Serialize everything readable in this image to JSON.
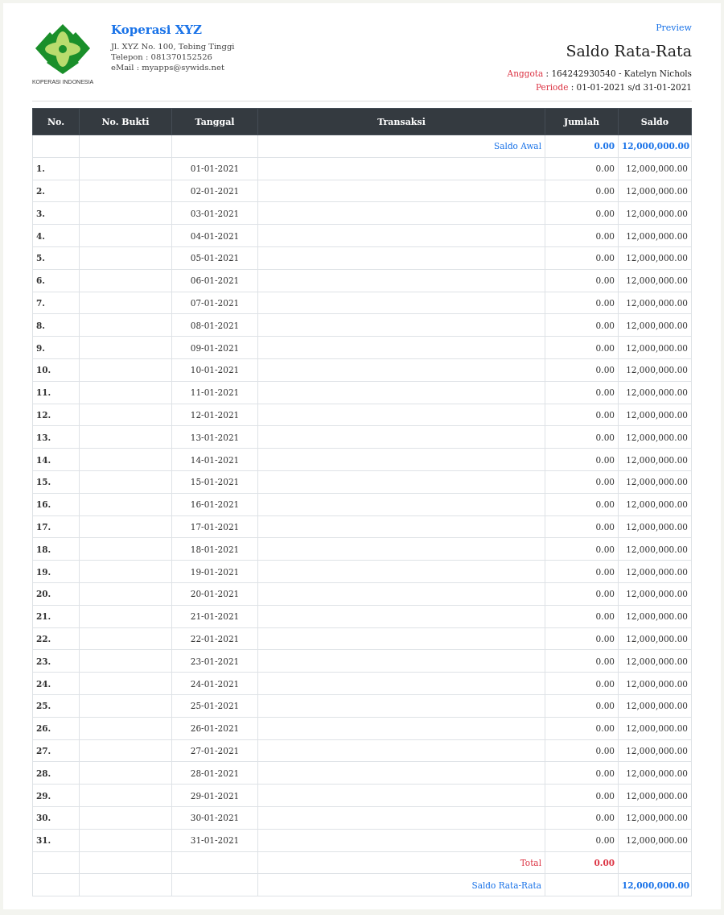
{
  "company": {
    "logo_caption": "KOPERASI INDONESIA",
    "name": "Koperasi XYZ",
    "address": "Jl. XYZ No. 100, Tebing Tinggi",
    "phone": "Telepon : 081370152526",
    "email": "eMail : myapps@sywids.net"
  },
  "preview_link": "Preview",
  "report": {
    "title": "Saldo Rata-Rata",
    "meta": [
      {
        "label": "Anggota",
        "value": " : 164242930540 - Katelyn Nichols"
      },
      {
        "label": "Periode",
        "value": " : 01-01-2021 s/d 31-01-2021"
      }
    ]
  },
  "table": {
    "columns": [
      "No.",
      "No. Bukti",
      "Tanggal",
      "Transaksi",
      "Jumlah",
      "Saldo"
    ],
    "opening": {
      "kind": "opening",
      "label": "Saldo Awal",
      "jumlah": "0.00",
      "saldo": "12,000,000.00"
    },
    "rows": [
      {
        "no": "1.",
        "tanggal": "01-01-2021",
        "jumlah": "0.00",
        "saldo": "12,000,000.00"
      },
      {
        "no": "2.",
        "tanggal": "02-01-2021",
        "jumlah": "0.00",
        "saldo": "12,000,000.00"
      },
      {
        "no": "3.",
        "tanggal": "03-01-2021",
        "jumlah": "0.00",
        "saldo": "12,000,000.00"
      },
      {
        "no": "4.",
        "tanggal": "04-01-2021",
        "jumlah": "0.00",
        "saldo": "12,000,000.00"
      },
      {
        "no": "5.",
        "tanggal": "05-01-2021",
        "jumlah": "0.00",
        "saldo": "12,000,000.00"
      },
      {
        "no": "6.",
        "tanggal": "06-01-2021",
        "jumlah": "0.00",
        "saldo": "12,000,000.00"
      },
      {
        "no": "7.",
        "tanggal": "07-01-2021",
        "jumlah": "0.00",
        "saldo": "12,000,000.00"
      },
      {
        "no": "8.",
        "tanggal": "08-01-2021",
        "jumlah": "0.00",
        "saldo": "12,000,000.00"
      },
      {
        "no": "9.",
        "tanggal": "09-01-2021",
        "jumlah": "0.00",
        "saldo": "12,000,000.00"
      },
      {
        "no": "10.",
        "tanggal": "10-01-2021",
        "jumlah": "0.00",
        "saldo": "12,000,000.00"
      },
      {
        "no": "11.",
        "tanggal": "11-01-2021",
        "jumlah": "0.00",
        "saldo": "12,000,000.00"
      },
      {
        "no": "12.",
        "tanggal": "12-01-2021",
        "jumlah": "0.00",
        "saldo": "12,000,000.00"
      },
      {
        "no": "13.",
        "tanggal": "13-01-2021",
        "jumlah": "0.00",
        "saldo": "12,000,000.00"
      },
      {
        "no": "14.",
        "tanggal": "14-01-2021",
        "jumlah": "0.00",
        "saldo": "12,000,000.00"
      },
      {
        "no": "15.",
        "tanggal": "15-01-2021",
        "jumlah": "0.00",
        "saldo": "12,000,000.00"
      },
      {
        "no": "16.",
        "tanggal": "16-01-2021",
        "jumlah": "0.00",
        "saldo": "12,000,000.00"
      },
      {
        "no": "17.",
        "tanggal": "17-01-2021",
        "jumlah": "0.00",
        "saldo": "12,000,000.00"
      },
      {
        "no": "18.",
        "tanggal": "18-01-2021",
        "jumlah": "0.00",
        "saldo": "12,000,000.00"
      },
      {
        "no": "19.",
        "tanggal": "19-01-2021",
        "jumlah": "0.00",
        "saldo": "12,000,000.00"
      },
      {
        "no": "20.",
        "tanggal": "20-01-2021",
        "jumlah": "0.00",
        "saldo": "12,000,000.00"
      },
      {
        "no": "21.",
        "tanggal": "21-01-2021",
        "jumlah": "0.00",
        "saldo": "12,000,000.00"
      },
      {
        "no": "22.",
        "tanggal": "22-01-2021",
        "jumlah": "0.00",
        "saldo": "12,000,000.00"
      },
      {
        "no": "23.",
        "tanggal": "23-01-2021",
        "jumlah": "0.00",
        "saldo": "12,000,000.00"
      },
      {
        "no": "24.",
        "tanggal": "24-01-2021",
        "jumlah": "0.00",
        "saldo": "12,000,000.00"
      },
      {
        "no": "25.",
        "tanggal": "25-01-2021",
        "jumlah": "0.00",
        "saldo": "12,000,000.00"
      },
      {
        "no": "26.",
        "tanggal": "26-01-2021",
        "jumlah": "0.00",
        "saldo": "12,000,000.00"
      },
      {
        "no": "27.",
        "tanggal": "27-01-2021",
        "jumlah": "0.00",
        "saldo": "12,000,000.00"
      },
      {
        "no": "28.",
        "tanggal": "28-01-2021",
        "jumlah": "0.00",
        "saldo": "12,000,000.00"
      },
      {
        "no": "29.",
        "tanggal": "29-01-2021",
        "jumlah": "0.00",
        "saldo": "12,000,000.00"
      },
      {
        "no": "30.",
        "tanggal": "30-01-2021",
        "jumlah": "0.00",
        "saldo": "12,000,000.00"
      },
      {
        "no": "31.",
        "tanggal": "31-01-2021",
        "jumlah": "0.00",
        "saldo": "12,000,000.00"
      }
    ],
    "summary": [
      {
        "kind": "total",
        "label": "Total",
        "jumlah": "0.00"
      },
      {
        "kind": "average",
        "label": "Saldo Rata-Rata",
        "saldo": "12,000,000.00"
      }
    ]
  }
}
